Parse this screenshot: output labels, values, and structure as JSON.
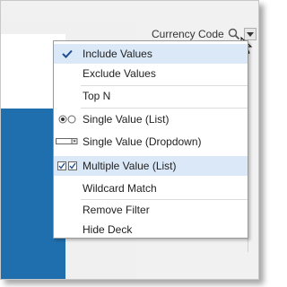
{
  "header": {
    "field_label": "Currency Code",
    "search_icon": "search-icon",
    "dropdown_icon": "chevron-down-icon"
  },
  "menu": {
    "items": [
      {
        "label": "Include Values",
        "icon": "check-icon",
        "selected": true
      },
      {
        "label": "Exclude Values",
        "icon": null,
        "selected": false
      },
      {
        "label": "Top N",
        "icon": null,
        "selected": false
      },
      {
        "label": "Single Value (List)",
        "icon": "radio-list-icon",
        "selected": false
      },
      {
        "label": "Single Value (Dropdown)",
        "icon": "dropdown-list-icon",
        "selected": false
      },
      {
        "label": "Multiple Value (List)",
        "icon": "checkbox-list-icon",
        "selected": true
      },
      {
        "label": "Wildcard Match",
        "icon": null,
        "selected": false
      },
      {
        "label": "Remove Filter",
        "icon": null,
        "selected": false
      },
      {
        "label": "Hide Deck",
        "icon": null,
        "selected": false
      }
    ]
  },
  "colors": {
    "selected_bg": "#dbe8f7",
    "accent_blue": "#1f6fae",
    "menu_border": "#9a9a9a"
  }
}
